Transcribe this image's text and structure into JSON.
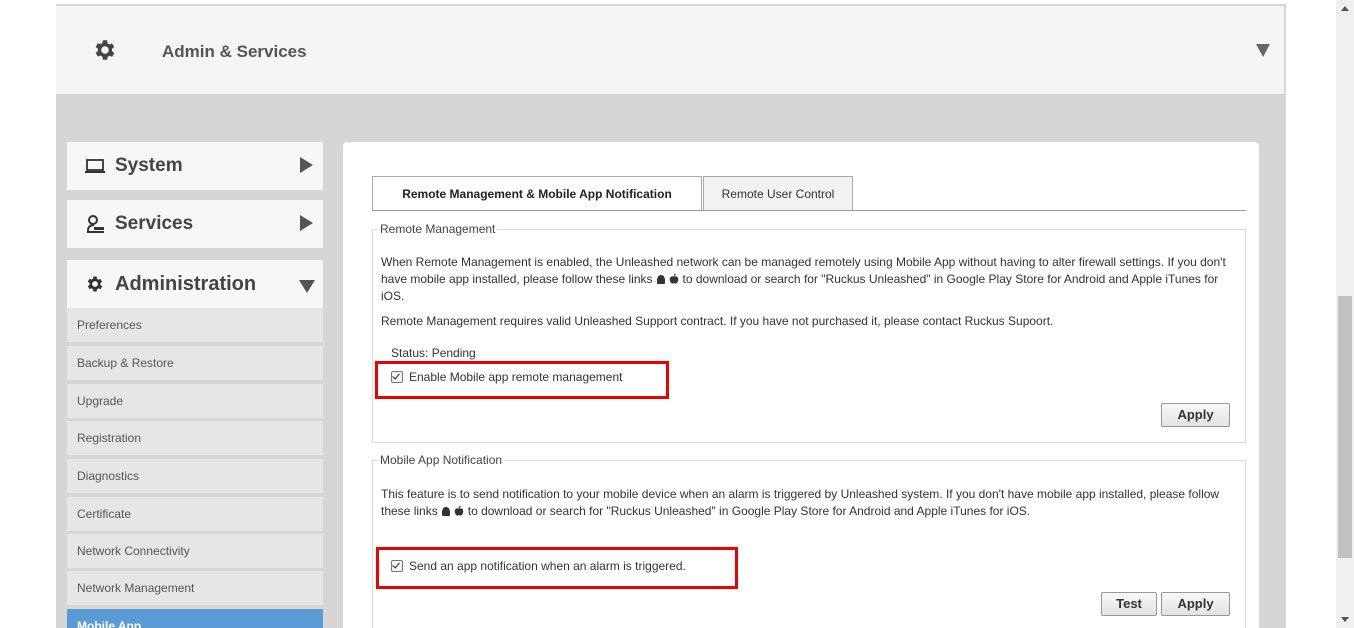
{
  "header": {
    "title": "Admin & Services",
    "icon": "gear-icon"
  },
  "sidebar": {
    "system": {
      "label": "System",
      "icon": "laptop-icon"
    },
    "services": {
      "label": "Services",
      "icon": "services-icon"
    },
    "administration": {
      "label": "Administration",
      "icon": "gear-icon"
    },
    "items": [
      {
        "label": "Preferences"
      },
      {
        "label": "Backup & Restore"
      },
      {
        "label": "Upgrade"
      },
      {
        "label": "Registration"
      },
      {
        "label": "Diagnostics"
      },
      {
        "label": "Certificate"
      },
      {
        "label": "Network Connectivity"
      },
      {
        "label": "Network Management"
      },
      {
        "label": "Mobile App",
        "active": true
      }
    ]
  },
  "tabs": [
    {
      "label": "Remote Management & Mobile App Notification",
      "active": true
    },
    {
      "label": "Remote User Control",
      "active": false
    }
  ],
  "remote_management": {
    "legend": "Remote Management",
    "desc_part1": "When Remote Management is enabled, the Unleashed network can be managed remotely using Mobile App without having to alter firewall settings. If you don't have mobile app installed, please follow these links",
    "desc_part2": "to download or search for \"Ruckus Unleashed\" in Google Play Store for Android and Apple iTunes for iOS.",
    "desc2": "Remote Management requires valid Unleashed Support contract. If you have not purchased it, please contact Ruckus Supoort.",
    "status": "Status: Pending",
    "checkbox_label": "Enable Mobile app remote management",
    "checked": true,
    "apply_label": "Apply"
  },
  "mobile_notification": {
    "legend": "Mobile App Notification",
    "desc_part1": "This feature is to send notification to your mobile device when an alarm is triggered by Unleashed system. If you don't have mobile app installed, please follow these links",
    "desc_part2": "to download or search for \"Ruckus Unleashed\" in Google Play Store for Android and Apple iTunes for iOS.",
    "checkbox_label": "Send an app notification when an alarm is triggered.",
    "checked": true,
    "test_label": "Test",
    "apply_label": "Apply"
  },
  "colors": {
    "highlight": "#e00000",
    "active_item": "#5b9bd5"
  }
}
